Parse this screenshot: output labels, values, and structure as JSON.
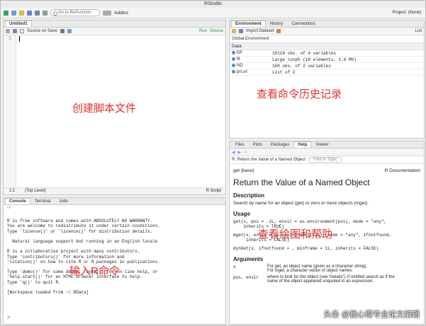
{
  "title": "RStudio",
  "toolbar": {
    "goto": "Go to file/function",
    "addins": "Addins",
    "project": "Project: (None)"
  },
  "editor": {
    "tab": "Untitled1",
    "source_on_save": "Source on Save",
    "run": "Run",
    "source": "Source",
    "line": "1",
    "status_pos": "1:1",
    "status_level": "(Top Level)",
    "status_type": "R Script",
    "annotation": "创建脚本文件"
  },
  "console": {
    "tabs": [
      "Console",
      "Terminal",
      "Jobs"
    ],
    "path": "~/",
    "lines": [
      "",
      "R is free software and comes with ABSOLUTELY NO WARRANTY.",
      "You are welcome to redistribute it under certain conditions.",
      "Type 'license()' or 'licence()' for distribution details.",
      "",
      "  Natural language support but running in an English locale",
      "",
      "R is a collaborative project with many contributors.",
      "Type 'contributors()' for more information and",
      "'citation()' on how to cite R or R packages in publications.",
      "",
      "Type 'demo()' for some demos, 'help()' for on-line help, or",
      "'help.start()' for an HTML browser interface to help.",
      "Type 'q()' to quit R.",
      "",
      "[Workspace loaded from ~/.RData]",
      ""
    ],
    "prompt": ">",
    "annotation": "输入R命令"
  },
  "env": {
    "tabs": [
      "Environment",
      "History",
      "Connections"
    ],
    "import": "Import Dataset",
    "list": "List",
    "global": "Global Environment",
    "section": "Data",
    "rows": [
      {
        "name": "DF",
        "value": "10116 obs. of 4 variables"
      },
      {
        "name": "fit",
        "value": "Large coxph (18 elements, 1.6 Mb)"
      },
      {
        "name": "ND",
        "value": "160 obs. of 2 variables"
      },
      {
        "name": "prs.nl",
        "value": "List of 2"
      }
    ],
    "annotation": "查看命令历史记录"
  },
  "help": {
    "tabs": [
      "Files",
      "Plots",
      "Packages",
      "Help",
      "Viewer"
    ],
    "topic": "R: Return the Value of a Named Object",
    "find": "Find in Topic",
    "pkg": "get {base}",
    "doc": "R Documentation",
    "h1": "Return the Value of a Named Object",
    "h_desc": "Description",
    "desc": "Search by name for an object (get) or zero or more objects (mget).",
    "h_usage": "Usage",
    "usage1": "get(x, pos = -1L, envir = as.environment(pos), mode = \"any\",\n    inherits = TRUE)",
    "usage2": "mget(x, envir = as.environment(-1L), mode = \"any\", ifnotfound,\n     inherits = FALSE)",
    "usage3": "dynGet(x, ifnotfound = , minframe = 1L, inherits = FALSE)",
    "h_args": "Arguments",
    "arg1_name": "x",
    "arg1": "For get, an object name (given as a character string).",
    "arg1b": "For mget, a character vector of object names.",
    "arg2_name": "pos, envir",
    "arg2": "where to look for the object (see 'Details'); if omitted search as if the",
    "arg2b": "name of the object appeared unquoted in an expression.",
    "annotation": "查看绘图和帮助",
    "watermark": "头条 @我心得专业论文编辑"
  }
}
